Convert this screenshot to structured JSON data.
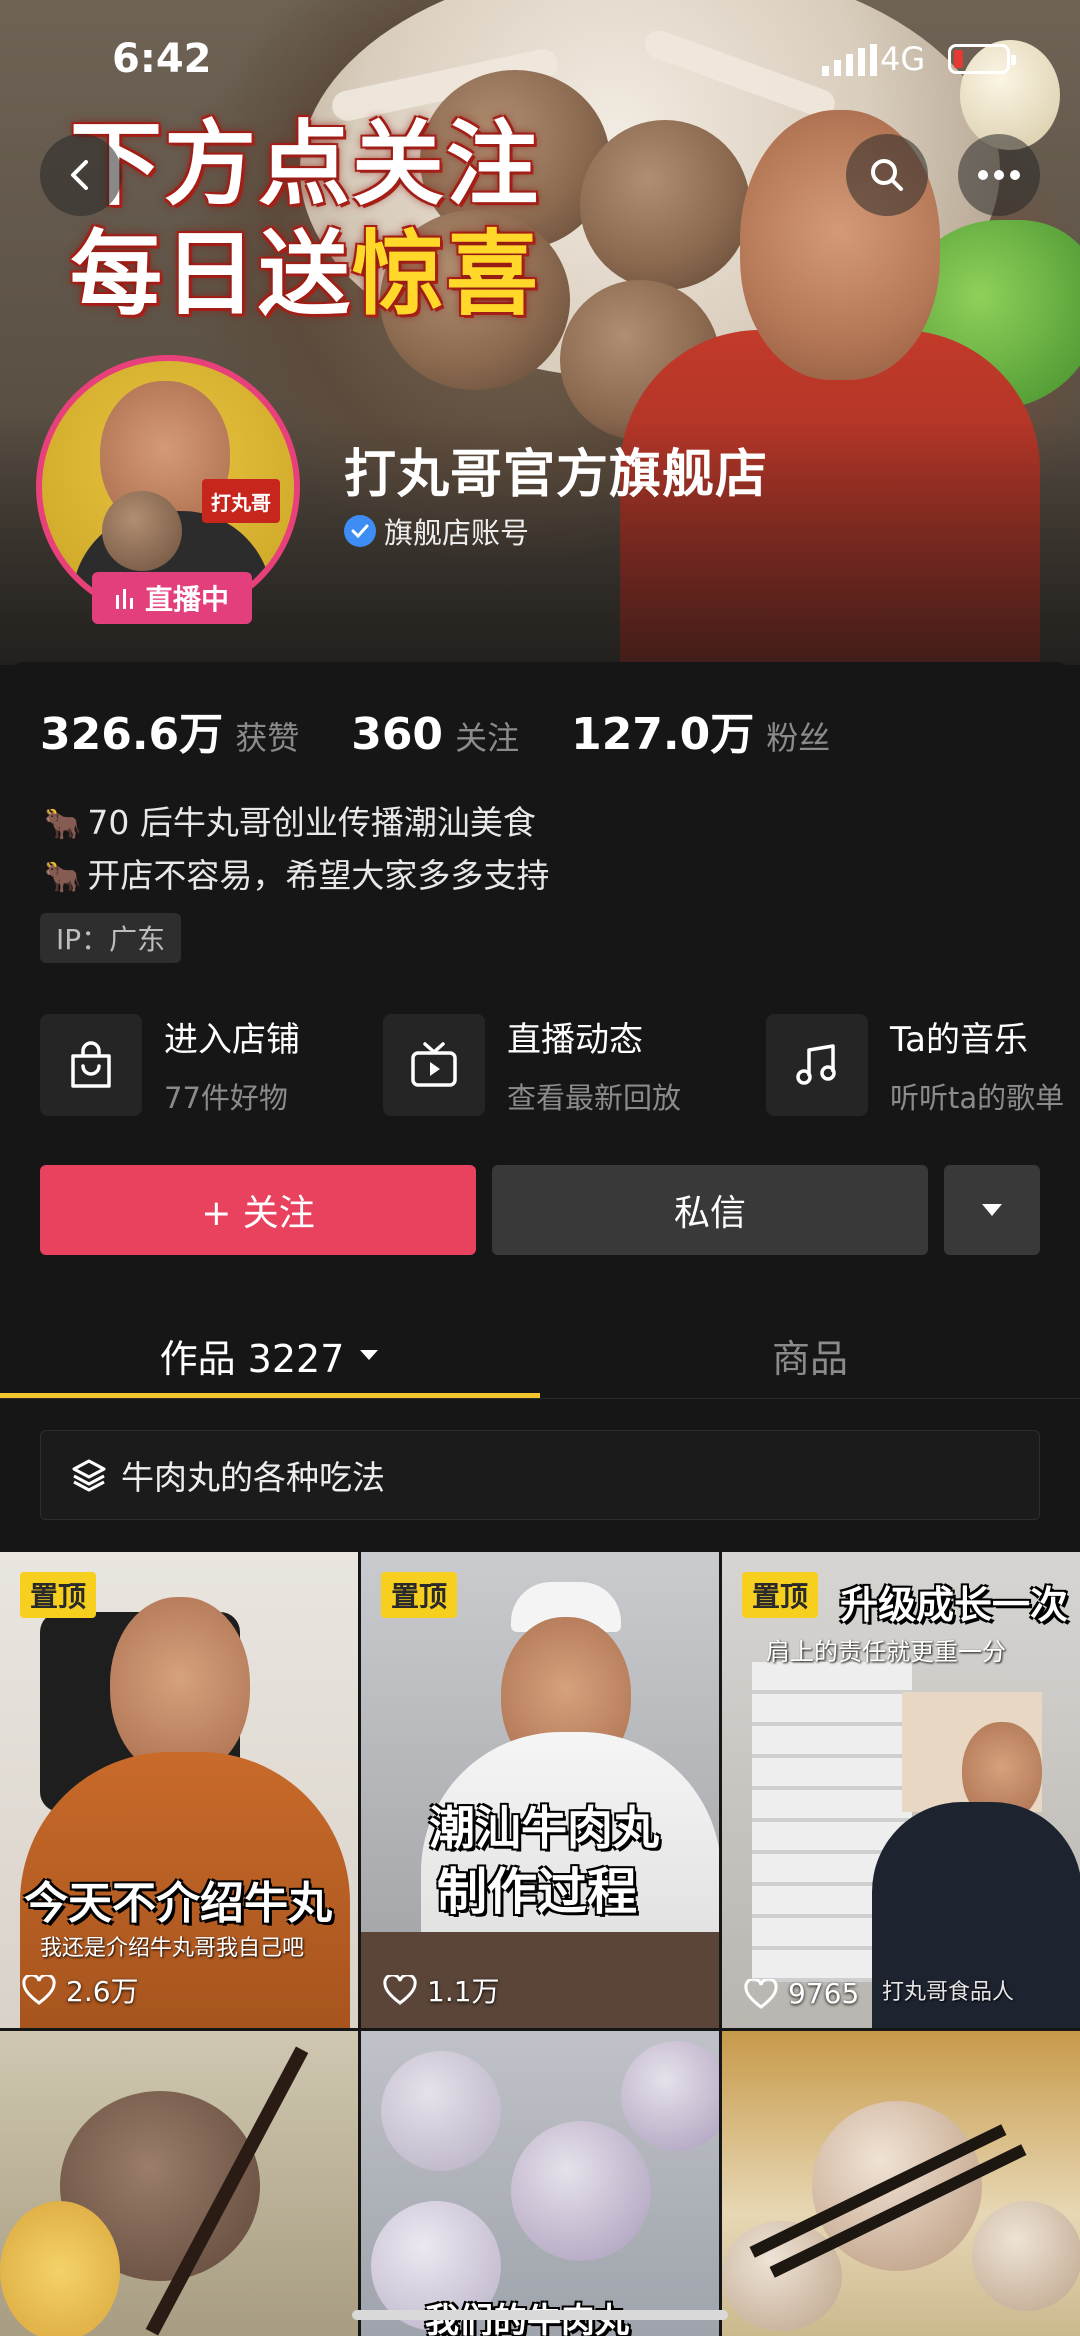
{
  "status_bar": {
    "time": "6:42",
    "network": "4G"
  },
  "banner": {
    "headline_line1": "下方点关注",
    "headline_line2_white": "每日送",
    "headline_line2_yellow": "惊喜",
    "avatar_logo_text": "打丸哥"
  },
  "profile": {
    "name": "打丸哥官方旗舰店",
    "verified_label": "旗舰店账号",
    "live_label": "直播中"
  },
  "stats": [
    {
      "value": "326.6万",
      "label": "获赞"
    },
    {
      "value": "360",
      "label": "关注"
    },
    {
      "value": "127.0万",
      "label": "粉丝"
    }
  ],
  "bio": {
    "line1": "70 后牛丸哥创业传播潮汕美食",
    "line2": "开店不容易，希望大家多多支持",
    "emoji": "🐂",
    "ip": "IP：广东"
  },
  "features": [
    {
      "title": "进入店铺",
      "subtitle": "77件好物",
      "icon": "shopping-bag-icon"
    },
    {
      "title": "直播动态",
      "subtitle": "查看最新回放",
      "icon": "tv-icon"
    },
    {
      "title": "Ta的音乐",
      "subtitle": "听听ta的歌单",
      "icon": "music-note-icon"
    }
  ],
  "actions": {
    "follow": "+ 关注",
    "message": "私信"
  },
  "tabs": {
    "works": "作品 3227",
    "goods": "商品"
  },
  "collection": {
    "title": "牛肉丸的各种吃法"
  },
  "grid": [
    {
      "pinned": "置顶",
      "likes": "2.6万",
      "caption": "今天不介绍牛丸",
      "subcaption": "我还是介绍牛丸哥我自己吧"
    },
    {
      "pinned": "置顶",
      "likes": "1.1万",
      "caption_line1": "潮汕牛肉丸",
      "caption_line2": "制作过程"
    },
    {
      "pinned": "置顶",
      "likes": "9765",
      "caption_line1": "升级成长一次",
      "caption_line2": "肩上的责任就更重一分",
      "watermark": "打丸哥食品人"
    },
    {},
    {
      "caption": "我们的牛肉丸"
    },
    {}
  ],
  "colors": {
    "accent": "#e8425f",
    "pin": "#f6cf1f",
    "live": "#e33f7c",
    "tab_underline": "#f3c62e"
  }
}
